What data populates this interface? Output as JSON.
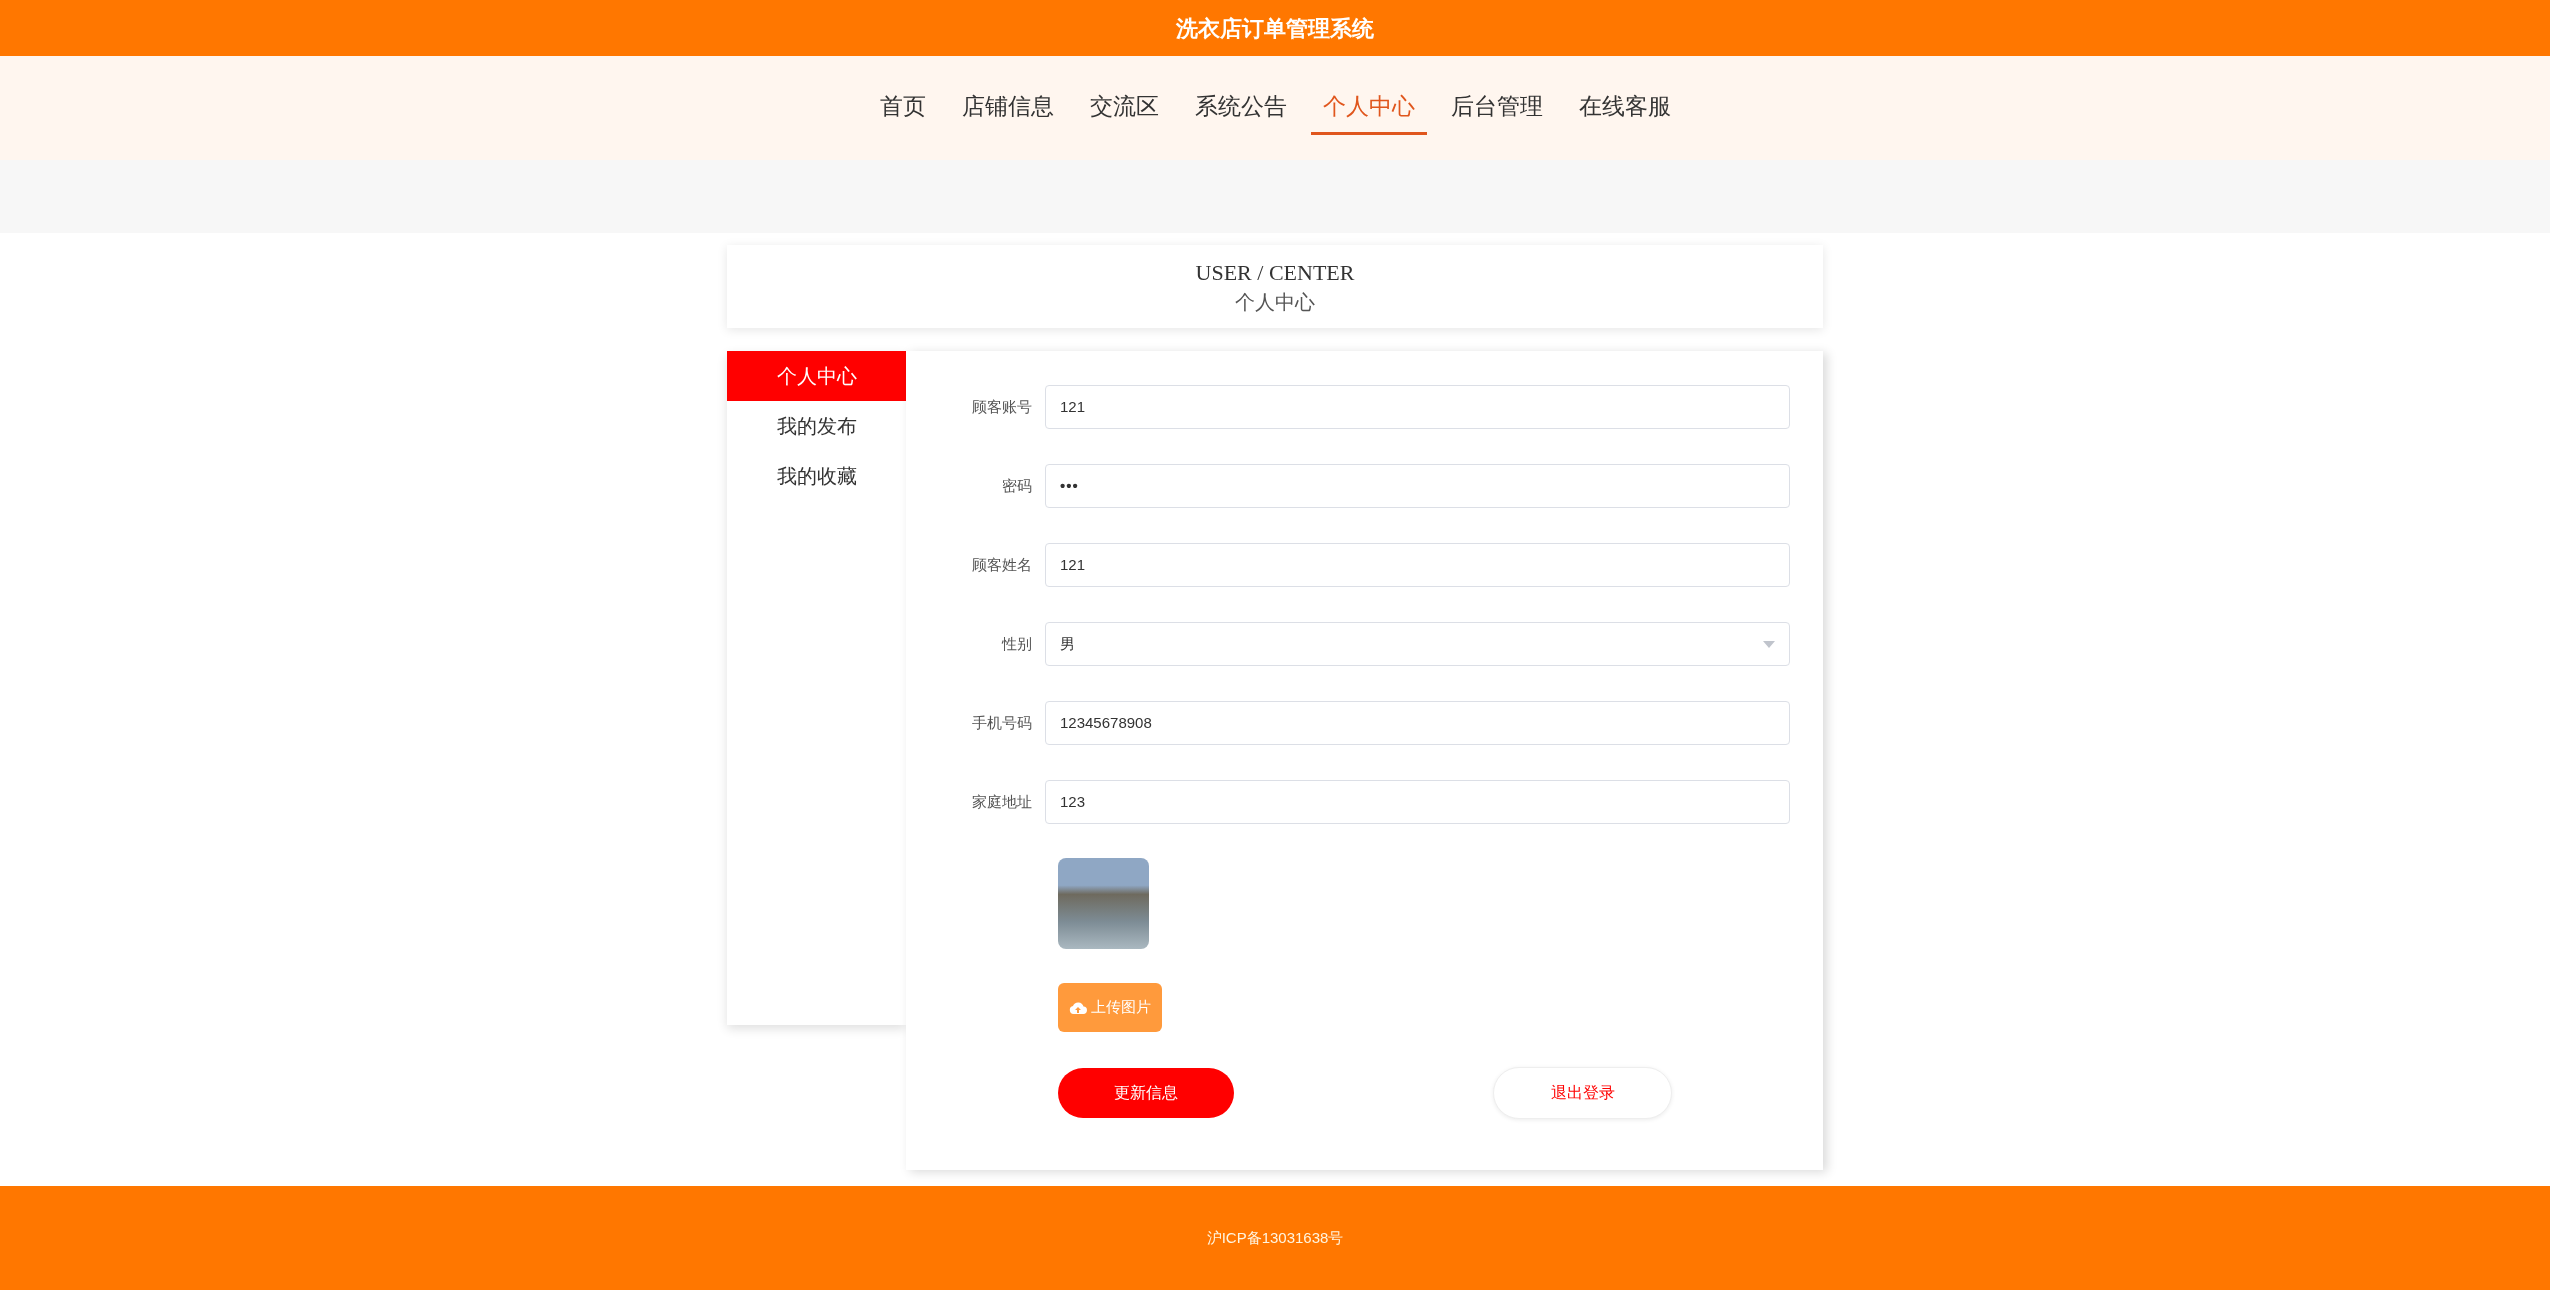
{
  "header": {
    "title": "洗衣店订单管理系统"
  },
  "nav": [
    {
      "label": "首页",
      "selected": false
    },
    {
      "label": "店铺信息",
      "selected": false
    },
    {
      "label": "交流区",
      "selected": false
    },
    {
      "label": "系统公告",
      "selected": false
    },
    {
      "label": "个人中心",
      "selected": true
    },
    {
      "label": "后台管理",
      "selected": false
    },
    {
      "label": "在线客服",
      "selected": false
    }
  ],
  "section_title": {
    "english": "USER / CENTER",
    "chinese": "个人中心"
  },
  "sidebar": [
    {
      "label": "个人中心",
      "selected": true
    },
    {
      "label": "我的发布",
      "selected": false
    },
    {
      "label": "我的收藏",
      "selected": false
    }
  ],
  "form": {
    "fields": [
      {
        "label": "顾客账号",
        "kind": "text",
        "value": "121"
      },
      {
        "label": "密码",
        "kind": "password",
        "value": "•••"
      },
      {
        "label": "顾客姓名",
        "kind": "text",
        "value": "121"
      },
      {
        "label": "性别",
        "kind": "select",
        "value": "男"
      },
      {
        "label": "手机号码",
        "kind": "text",
        "value": "12345678908"
      },
      {
        "label": "家庭地址",
        "kind": "text",
        "value": "123"
      }
    ],
    "upload_button": "上传图片",
    "update_button": "更新信息",
    "logout_button": "退出登录"
  },
  "footer": {
    "text": "沪ICP备13031638号"
  }
}
